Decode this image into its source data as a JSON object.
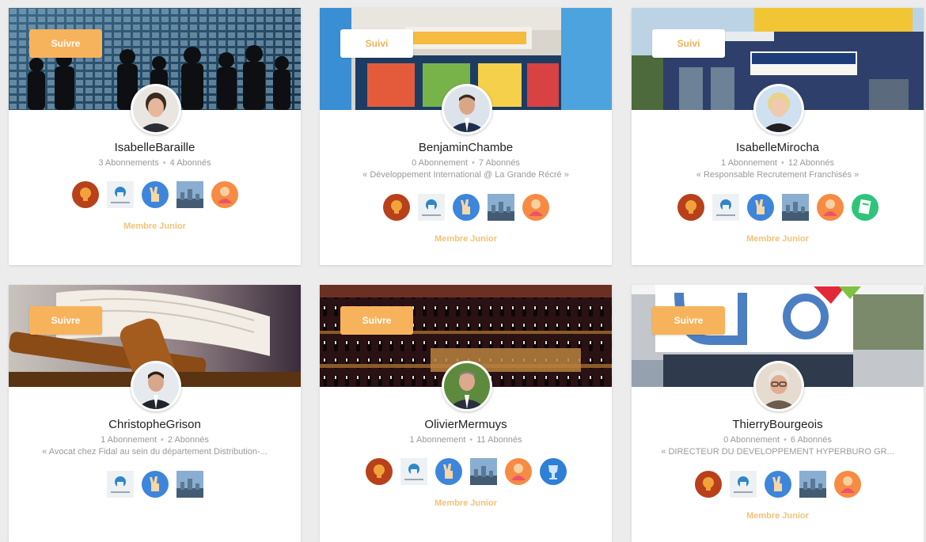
{
  "colors": {
    "accent": "#f7b35c",
    "rank": "#f3c27a",
    "muted": "#999999"
  },
  "cards": [
    {
      "follow_label": "Suivre",
      "follow_state": "suivre",
      "name": "IsabelleBaraille",
      "subscriptions": "3 Abonnements",
      "followers": "4 Abonnés",
      "bio": "",
      "badges": [
        "bulb-badge-icon",
        "heart-badge-icon",
        "peace-hand-badge-icon",
        "city-badge-icon",
        "person-badge-icon"
      ],
      "rank": "Membre Junior"
    },
    {
      "follow_label": "Suivi",
      "follow_state": "suivi",
      "name": "BenjaminChambe",
      "subscriptions": "0 Abonnement",
      "followers": "7 Abonnés",
      "bio": "« Développement International @ La Grande Récré »",
      "badges": [
        "bulb-badge-icon",
        "heart-badge-icon",
        "peace-hand-badge-icon",
        "city-badge-icon",
        "person-badge-icon"
      ],
      "rank": "Membre Junior"
    },
    {
      "follow_label": "Suivi",
      "follow_state": "suivi",
      "name": "IsabelleMirocha",
      "subscriptions": "1 Abonnement",
      "followers": "12 Abonnés",
      "bio": "« Responsable Recrutement Franchisés »",
      "badges": [
        "bulb-badge-icon",
        "heart-badge-icon",
        "peace-hand-badge-icon",
        "city-badge-icon",
        "person-badge-icon",
        "document-badge-icon"
      ],
      "rank": "Membre Junior"
    },
    {
      "follow_label": "Suivre",
      "follow_state": "suivre",
      "name": "ChristopheGrison",
      "subscriptions": "1 Abonnement",
      "followers": "2 Abonnés",
      "bio": "« Avocat chez Fidal au sein du département Distribution-...",
      "badges": [
        "heart-badge-icon",
        "peace-hand-badge-icon",
        "city-badge-icon"
      ],
      "rank": ""
    },
    {
      "follow_label": "Suivre",
      "follow_state": "suivre",
      "name": "OlivierMermuys",
      "subscriptions": "1 Abonnement",
      "followers": "11 Abonnés",
      "bio": "",
      "badges": [
        "bulb-badge-icon",
        "heart-badge-icon",
        "peace-hand-badge-icon",
        "city-badge-icon",
        "person-badge-icon",
        "trophy-badge-icon"
      ],
      "rank": "Membre Junior"
    },
    {
      "follow_label": "Suivre",
      "follow_state": "suivre",
      "name": "ThierryBourgeois",
      "subscriptions": "0 Abonnement",
      "followers": "6 Abonnés",
      "bio": "« DIRECTEUR DU DEVELOPPEMENT HYPERBURO GR...",
      "badges": [
        "bulb-badge-icon",
        "heart-badge-icon",
        "peace-hand-badge-icon",
        "city-badge-icon",
        "person-badge-icon"
      ],
      "rank": "Membre Junior"
    }
  ]
}
